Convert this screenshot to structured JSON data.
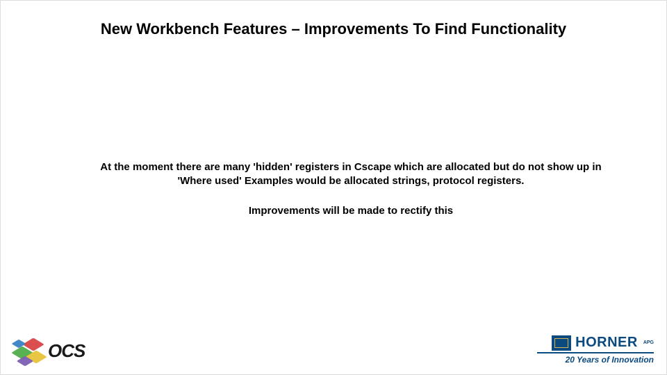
{
  "title": "New Workbench Features – Improvements To Find Functionality",
  "body": {
    "p1": "At the moment there are many 'hidden' registers in Cscape which are allocated but do not show up in 'Where used' Examples would be allocated strings, protocol registers.",
    "p2": "Improvements will be made to rectify this"
  },
  "footer": {
    "left_logo_text": "OCS",
    "right_logo_text": "HORNER",
    "right_logo_sub": "APG",
    "right_tagline": "20 Years of Innovation"
  }
}
